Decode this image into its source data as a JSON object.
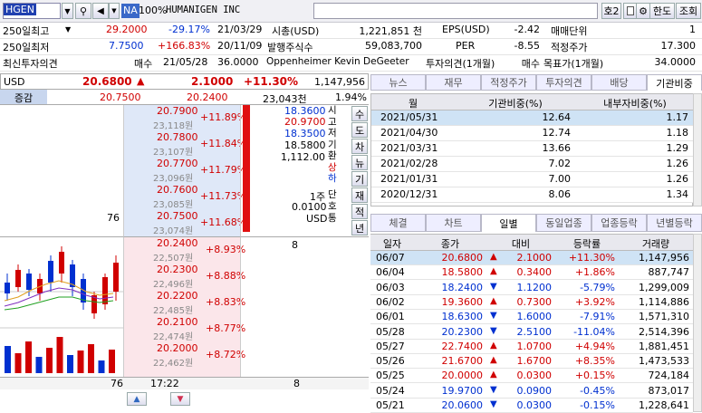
{
  "toolbar": {
    "symbol": "HGEN",
    "na": "NA",
    "pct": "100%",
    "name": "HUMANIGEN INC",
    "no": "호2",
    "lang": "한도",
    "query": "조회"
  },
  "info": {
    "r1": {
      "label": "250일최고",
      "price": "29.2000",
      "chg": "-29.17%",
      "date": "21/03/29",
      "k1": "시총(USD)",
      "v1": "1,221,851 천",
      "k2": "EPS(USD)",
      "v2": "-2.42",
      "k3": "매매단위",
      "v3": "1"
    },
    "r2": {
      "label": "250일최저",
      "price": "7.7500",
      "chg": "+166.83%",
      "date": "20/11/09",
      "k1": "발행주식수",
      "v1": "59,083,700",
      "k2": "PER",
      "v2": "-8.55",
      "k3": "적정주가",
      "v3": "17.300"
    },
    "r3": {
      "label": "최신투자의견",
      "op": "매수",
      "date": "21/05/28",
      "tp": "36.0000",
      "analyst": "Oppenheimer Kevin DeGeeter",
      "k2": "투자의견(1개월)",
      "v2": "매수",
      "k3": "목표가(1개월)",
      "v3": "34.0000"
    }
  },
  "quote": {
    "cur": "USD",
    "price": "20.6800",
    "arrow": "▲",
    "chg": "2.1000",
    "pct": "+11.30%",
    "vol": "1,147,956",
    "label": "증감",
    "p2": "20.7500",
    "chg2": "20.2400",
    "amt": "23,043천",
    "pct2": "1.94%"
  },
  "asks": [
    {
      "p": "20.7900",
      "k": "23,118원",
      "c": "+11.89%"
    },
    {
      "p": "20.7800",
      "k": "23,107원",
      "c": "+11.84%"
    },
    {
      "p": "20.7700",
      "k": "23,096원",
      "c": "+11.79%"
    },
    {
      "p": "20.7600",
      "k": "23,085원",
      "c": "+11.73%"
    },
    {
      "p": "20.7500",
      "k": "23,074원",
      "c": "+11.68%",
      "q": "76"
    }
  ],
  "bids": [
    {
      "p": "20.2400",
      "k": "22,507원",
      "c": "+8.93%",
      "q": "8"
    },
    {
      "p": "20.2300",
      "k": "22,496원",
      "c": "+8.88%"
    },
    {
      "p": "20.2200",
      "k": "22,485원",
      "c": "+8.83%"
    },
    {
      "p": "20.2100",
      "k": "22,474원",
      "c": "+8.77%"
    },
    {
      "p": "20.2000",
      "k": "22,462원",
      "c": "+8.72%"
    }
  ],
  "ohlc": {
    "o": "18.3600",
    "h": "20.9700",
    "l": "18.3500",
    "ref": "18.5800",
    "unitval": "1,112.00",
    "qty": "1주",
    "tick": "0.0100",
    "ccy": "USD"
  },
  "side_labels": [
    "시",
    "고",
    "저",
    "기",
    "환",
    "상",
    "하"
  ],
  "side_labels2": [
    "단",
    "호",
    "통"
  ],
  "side_tabs": [
    "수",
    "도",
    "차",
    "뉴",
    "기",
    "재",
    "적",
    "년"
  ],
  "footer": {
    "qty_total": "76",
    "time": "17:22",
    "bid_total": "8"
  },
  "top_tabs": [
    "뉴스",
    "재무",
    "적정주가",
    "투자의견",
    "배당",
    "기관비중"
  ],
  "inst": {
    "headers": [
      "월",
      "기관비중(%)",
      "내부자비중(%)"
    ],
    "rows": [
      [
        "2021/05/31",
        "12.64",
        "1.17"
      ],
      [
        "2021/04/30",
        "12.74",
        "1.18"
      ],
      [
        "2021/03/31",
        "13.66",
        "1.29"
      ],
      [
        "2021/02/28",
        "7.02",
        "1.26"
      ],
      [
        "2021/01/31",
        "7.00",
        "1.26"
      ],
      [
        "2020/12/31",
        "8.06",
        "1.34"
      ]
    ]
  },
  "mid_tabs": [
    "체결",
    "차트",
    "일별",
    "동일업종",
    "업종등락",
    "년별등락"
  ],
  "daily": {
    "headers": [
      "일자",
      "종가",
      "대비",
      "등락률",
      "거래량"
    ],
    "rows": [
      {
        "d": "06/07",
        "c": "20.6800",
        "dir": "up",
        "diff": "2.1000",
        "pct": "+11.30%",
        "v": "1,147,956"
      },
      {
        "d": "06/04",
        "c": "18.5800",
        "dir": "up",
        "diff": "0.3400",
        "pct": "+1.86%",
        "v": "887,747"
      },
      {
        "d": "06/03",
        "c": "18.2400",
        "dir": "down",
        "diff": "1.1200",
        "pct": "-5.79%",
        "v": "1,299,009"
      },
      {
        "d": "06/02",
        "c": "19.3600",
        "dir": "up",
        "diff": "0.7300",
        "pct": "+3.92%",
        "v": "1,114,886"
      },
      {
        "d": "06/01",
        "c": "18.6300",
        "dir": "down",
        "diff": "1.6000",
        "pct": "-7.91%",
        "v": "1,571,310"
      },
      {
        "d": "05/28",
        "c": "20.2300",
        "dir": "down",
        "diff": "2.5100",
        "pct": "-11.04%",
        "v": "2,514,396"
      },
      {
        "d": "05/27",
        "c": "22.7400",
        "dir": "up",
        "diff": "1.0700",
        "pct": "+4.94%",
        "v": "1,881,451"
      },
      {
        "d": "05/26",
        "c": "21.6700",
        "dir": "up",
        "diff": "1.6700",
        "pct": "+8.35%",
        "v": "1,473,533"
      },
      {
        "d": "05/25",
        "c": "20.0000",
        "dir": "up",
        "diff": "0.0300",
        "pct": "+0.15%",
        "v": "724,184"
      },
      {
        "d": "05/24",
        "c": "19.9700",
        "dir": "down",
        "diff": "0.0900",
        "pct": "-0.45%",
        "v": "873,017"
      },
      {
        "d": "05/21",
        "c": "20.0600",
        "dir": "down",
        "diff": "0.0300",
        "pct": "-0.15%",
        "v": "1,228,641"
      }
    ]
  },
  "colors": {
    "up": "#d00000",
    "down": "#0030d0",
    "ask_bg": "#dfe8f8",
    "bid_bg": "#fbe6ea"
  }
}
